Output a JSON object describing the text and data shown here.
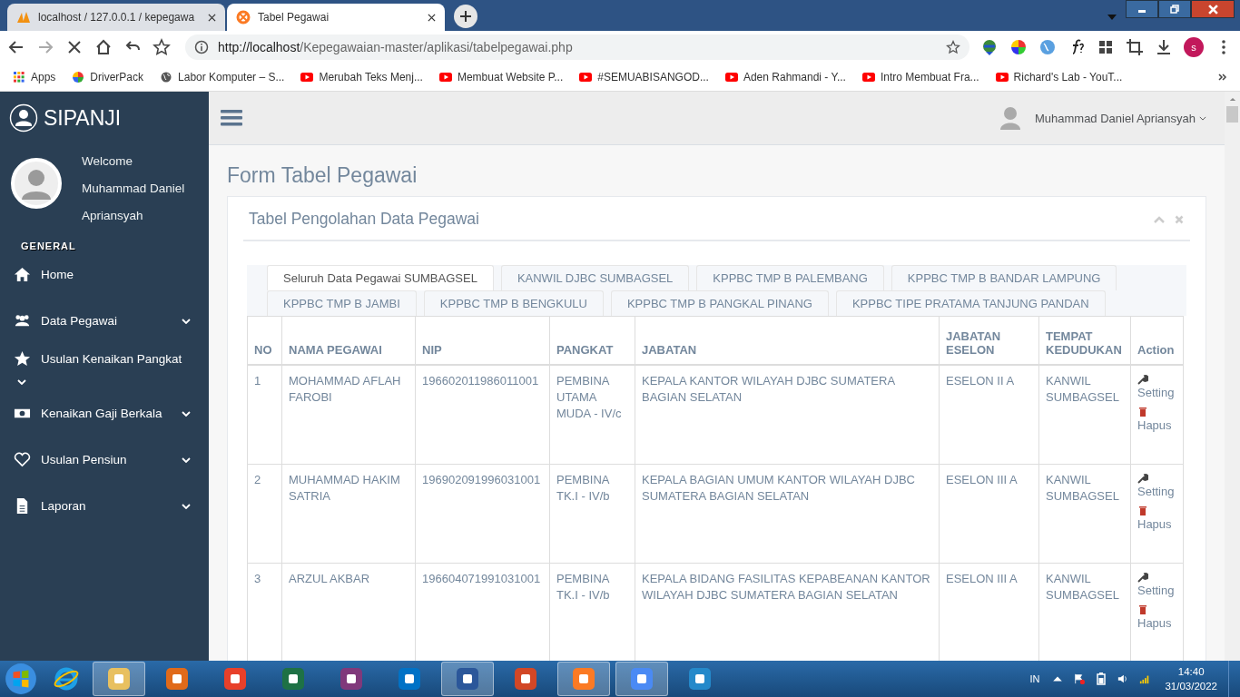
{
  "browser": {
    "tabs": [
      {
        "title": "localhost / 127.0.0.1 / kepegawa",
        "selected": false,
        "kind": "pma"
      },
      {
        "title": "Tabel Pegawai",
        "selected": true,
        "kind": "xampp"
      }
    ],
    "url_host": "http://localhost",
    "url_path": "/Kepegawaian-master/aplikasi/tabelpegawai.php",
    "profile": "s",
    "bookmarks": [
      {
        "label": "Apps",
        "kind": "apps"
      },
      {
        "label": "DriverPack",
        "kind": "driverpack"
      },
      {
        "label": "Labor Komputer – S...",
        "kind": "globe"
      },
      {
        "label": "Merubah Teks Menj...",
        "kind": "youtube"
      },
      {
        "label": "Membuat Website P...",
        "kind": "youtube"
      },
      {
        "label": "#SEMUABISANGOD...",
        "kind": "youtube"
      },
      {
        "label": "Aden Rahmandi - Y...",
        "kind": "youtube"
      },
      {
        "label": "Intro Membuat Fra...",
        "kind": "youtube"
      },
      {
        "label": "Richard's Lab - YouT...",
        "kind": "youtube"
      }
    ]
  },
  "sidebar": {
    "brand": "SIPANJI",
    "welcome": [
      "Welcome",
      "Muhammad Daniel",
      "Apriansyah"
    ],
    "section": "GENERAL",
    "items": [
      {
        "label": "Home",
        "kind": "home",
        "expandable": false
      },
      {
        "label": "Data Pegawai",
        "kind": "users",
        "expandable": true
      },
      {
        "label": "Usulan Kenaikan Pangkat",
        "kind": "star",
        "expandable": true
      },
      {
        "label": "Kenaikan Gaji Berkala",
        "kind": "money",
        "expandable": true
      },
      {
        "label": "Usulan Pensiun",
        "kind": "heart",
        "expandable": true
      },
      {
        "label": "Laporan",
        "kind": "file",
        "expandable": true
      }
    ]
  },
  "header": {
    "user": "Muhammad Daniel Apriansyah"
  },
  "page_title": "Form Tabel Pegawai",
  "panel": {
    "title": "Tabel Pengolahan Data Pegawai",
    "tab_rows": [
      [
        {
          "label": "Seluruh Data Pegawai SUMBAGSEL",
          "selected": true
        },
        {
          "label": "KANWIL DJBC SUMBAGSEL",
          "selected": false
        },
        {
          "label": "KPPBC TMP B PALEMBANG",
          "selected": false
        },
        {
          "label": "KPPBC TMP B BANDAR LAMPUNG",
          "selected": false
        }
      ],
      [
        {
          "label": "KPPBC TMP B JAMBI",
          "selected": false
        },
        {
          "label": "KPPBC TMP B BENGKULU",
          "selected": false
        },
        {
          "label": "KPPBC TMP B PANGKAL PINANG",
          "selected": false
        },
        {
          "label": "KPPBC TIPE PRATAMA TANJUNG PANDAN",
          "selected": false
        }
      ]
    ],
    "table": {
      "columns": [
        "NO",
        "NAMA PEGAWAI",
        "NIP",
        "PANGKAT",
        "JABATAN",
        "JABATAN ESELON",
        "TEMPAT KEDUDUKAN",
        "Action"
      ],
      "rows": [
        {
          "cells": [
            "1",
            "MOHAMMAD AFLAH FAROBI",
            "196602011986011001",
            "PEMBINA UTAMA MUDA - IV/c",
            "KEPALA KANTOR WILAYAH DJBC SUMATERA BAGIAN SELATAN",
            "ESELON II A",
            "KANWIL SUMBAGSEL"
          ],
          "actions": [
            "Setting",
            "Hapus"
          ]
        },
        {
          "cells": [
            "2",
            "MUHAMMAD HAKIM SATRIA",
            "196902091996031001",
            "PEMBINA TK.I - IV/b",
            "KEPALA BAGIAN UMUM KANTOR WILAYAH DJBC SUMATERA BAGIAN SELATAN",
            "ESELON III A",
            "KANWIL SUMBAGSEL"
          ],
          "actions": [
            "Setting",
            "Hapus"
          ]
        },
        {
          "cells": [
            "3",
            "ARZUL AKBAR",
            "196604071991031001",
            "PEMBINA TK.I - IV/b",
            "KEPALA BIDANG FASILITAS KEPABEANAN KANTOR WILAYAH DJBC SUMATERA BAGIAN SELATAN",
            "ESELON III A",
            "KANWIL SUMBAGSEL"
          ],
          "actions": [
            "Setting",
            "Hapus"
          ]
        }
      ]
    }
  },
  "taskbar": {
    "apps": [
      {
        "color": "#e8c060",
        "open": true
      },
      {
        "color": "#e06a1a",
        "open": false
      },
      {
        "color": "#e8402a",
        "open": false
      },
      {
        "color": "#1e7145",
        "open": false
      },
      {
        "color": "#80397b",
        "open": false
      },
      {
        "color": "#0072c6",
        "open": false
      },
      {
        "color": "#2b579a",
        "open": true
      },
      {
        "color": "#d24726",
        "open": false
      },
      {
        "color": "#fb7a24",
        "open": true
      },
      {
        "color": "#4a8af4",
        "open": true
      },
      {
        "color": "#2489ca",
        "open": false
      }
    ],
    "lang": "IN",
    "time": "14:40",
    "date": "31/03/2022"
  }
}
